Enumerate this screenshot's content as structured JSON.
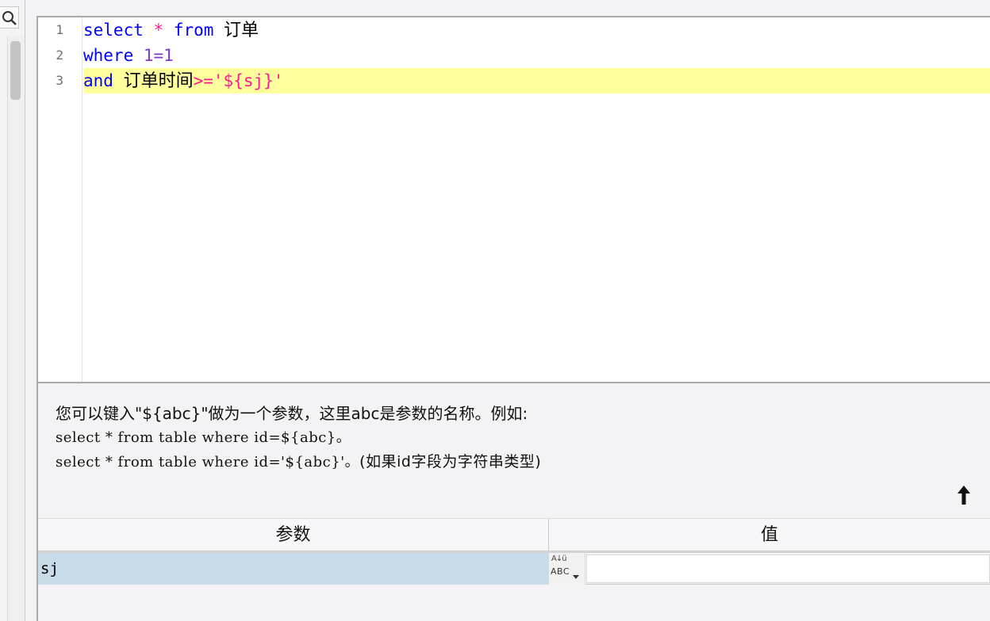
{
  "editor": {
    "line_numbers": [
      "1",
      "2",
      "3"
    ],
    "line1": {
      "kw_select": "select",
      "op_star": "*",
      "kw_from": "from",
      "table": "订单"
    },
    "line2": {
      "kw_where": "where",
      "expr": "1=1"
    },
    "line3": {
      "kw_and": "and",
      "column": "订单时间",
      "op": ">=",
      "value": "'${sj}'"
    }
  },
  "help": {
    "line1": "您可以键入\"${abc}\"做为一个参数，这里abc是参数的名称。例如:",
    "line2": "select * from table where id=${abc}。",
    "line3_code": "select * from table where id='${abc}'。",
    "line3_note": "(如果id字段为字符串类型)"
  },
  "params_table": {
    "header_param": "参数",
    "header_value": "值",
    "rows": [
      {
        "name": "sj",
        "type_top": "A↓ü",
        "type_label": "ABC",
        "value": ""
      }
    ]
  },
  "colors": {
    "keyword": "#0000ff",
    "operator": "#ff1a8c",
    "number": "#7a3dbf",
    "active_line": "#ffff9e",
    "selected_row": "#c8dbe8"
  },
  "icons": {
    "search": "search-icon",
    "up_arrow": "arrow-up-icon",
    "type_dropdown": "chevron-down-icon"
  }
}
